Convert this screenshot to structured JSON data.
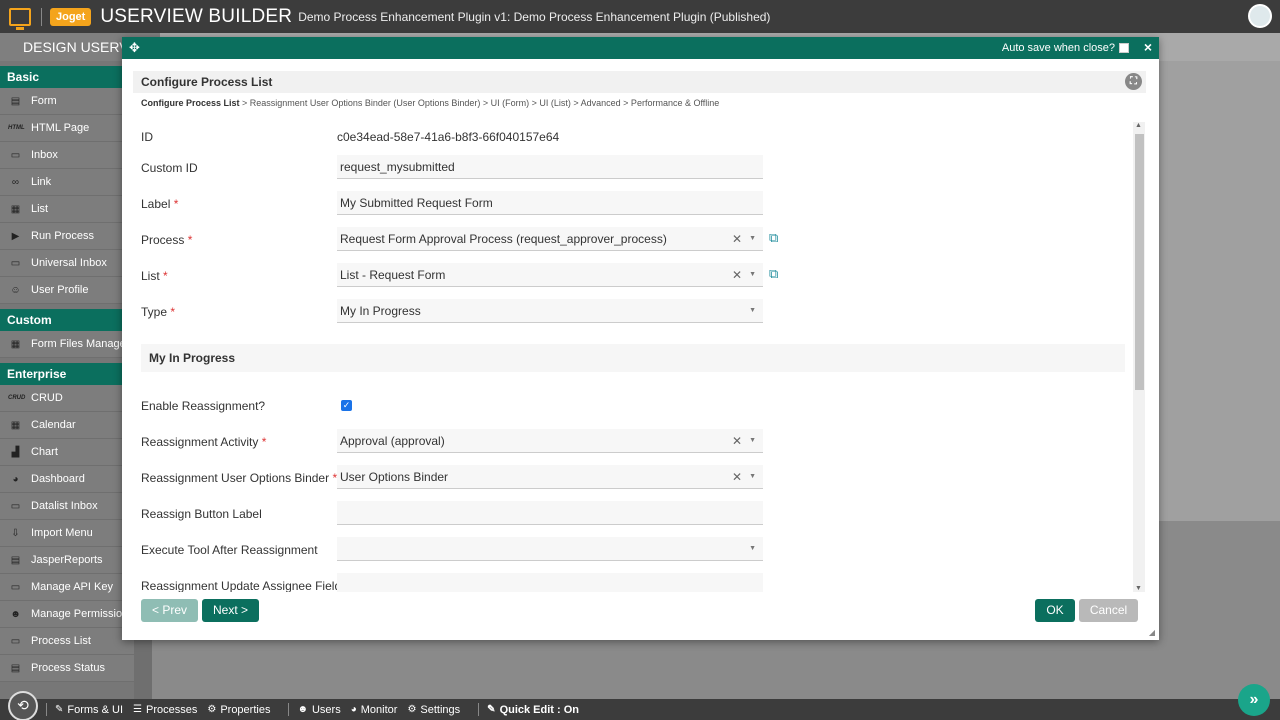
{
  "topbar": {
    "brand": "Joget",
    "title": "USERVIEW BUILDER",
    "subtitle": "Demo Process Enhancement Plugin v1: Demo Process Enhancement Plugin (Published)"
  },
  "tabbar": {
    "design_label": "DESIGN USERV"
  },
  "sidebar": {
    "sections": [
      {
        "title": "Basic",
        "items": [
          {
            "label": "Form",
            "icon": "form-icon"
          },
          {
            "label": "HTML Page",
            "icon": "html-icon"
          },
          {
            "label": "Inbox",
            "icon": "inbox-icon"
          },
          {
            "label": "Link",
            "icon": "link-icon"
          },
          {
            "label": "List",
            "icon": "table-icon"
          },
          {
            "label": "Run Process",
            "icon": "play-icon"
          },
          {
            "label": "Universal Inbox",
            "icon": "inbox-icon"
          },
          {
            "label": "User Profile",
            "icon": "user-icon"
          }
        ]
      },
      {
        "title": "Custom",
        "items": [
          {
            "label": "Form Files Manager",
            "icon": "files-icon"
          }
        ]
      },
      {
        "title": "Enterprise",
        "items": [
          {
            "label": "CRUD",
            "icon": "crud-icon"
          },
          {
            "label": "Calendar",
            "icon": "calendar-icon"
          },
          {
            "label": "Chart",
            "icon": "chart-icon"
          },
          {
            "label": "Dashboard",
            "icon": "dashboard-icon"
          },
          {
            "label": "Datalist Inbox",
            "icon": "inbox-icon"
          },
          {
            "label": "Import Menu",
            "icon": "import-icon"
          },
          {
            "label": "JasperReports",
            "icon": "report-icon"
          },
          {
            "label": "Manage API Key",
            "icon": "monitor-icon"
          },
          {
            "label": "Manage Permission",
            "icon": "users-icon"
          },
          {
            "label": "Process List",
            "icon": "inbox-icon"
          },
          {
            "label": "Process Status",
            "icon": "status-icon"
          }
        ]
      }
    ]
  },
  "dialog": {
    "autosave_label": "Auto save when close?",
    "panel_title": "Configure Process List",
    "breadcrumb": {
      "current": "Configure Process List",
      "rest": " > Reassignment User Options Binder (User Options Binder) > UI (Form) > UI (List) > Advanced > Performance & Offline"
    },
    "fields": {
      "id": {
        "label": "ID",
        "value": "c0e34ead-58e7-41a6-b8f3-66f040157e64"
      },
      "custom_id": {
        "label": "Custom ID",
        "value": "request_mysubmitted"
      },
      "label": {
        "label": "Label",
        "required": "*",
        "value": "My Submitted Request Form"
      },
      "process": {
        "label": "Process",
        "required": "*",
        "value": "Request Form Approval Process (request_approver_process)"
      },
      "list": {
        "label": "List",
        "required": "*",
        "value": "List - Request Form"
      },
      "type": {
        "label": "Type",
        "required": "*",
        "value": "My In Progress"
      },
      "section_title": "My In Progress",
      "enable_reassignment": {
        "label": "Enable Reassignment?",
        "checked": true
      },
      "reassignment_activity": {
        "label": "Reassignment Activity",
        "required": "*",
        "value": "Approval (approval)"
      },
      "reassignment_binder": {
        "label": "Reassignment User Options Binder",
        "required": "*",
        "value": "User Options Binder"
      },
      "reassign_button_label": {
        "label": "Reassign Button Label",
        "value": ""
      },
      "execute_tool": {
        "label": "Execute Tool After Reassignment",
        "value": ""
      },
      "update_assignee": {
        "label": "Reassignment Update Assignee Field",
        "value": ""
      }
    },
    "buttons": {
      "prev": "< Prev",
      "next": "Next >",
      "ok": "OK",
      "cancel": "Cancel"
    }
  },
  "bottombar": {
    "items": [
      {
        "label": "Forms & UI",
        "icon": "edit-icon"
      },
      {
        "label": "Processes",
        "icon": "list-icon"
      },
      {
        "label": "Properties",
        "icon": "gear-icon"
      },
      {
        "label": "Users",
        "icon": "users-icon"
      },
      {
        "label": "Monitor",
        "icon": "dashboard-icon"
      },
      {
        "label": "Settings",
        "icon": "gears-icon"
      }
    ],
    "quick_edit": "Quick Edit : On"
  },
  "colors": {
    "accent": "#0b6f5e",
    "joget_orange": "#f4a41c",
    "required": "#dd3333"
  }
}
